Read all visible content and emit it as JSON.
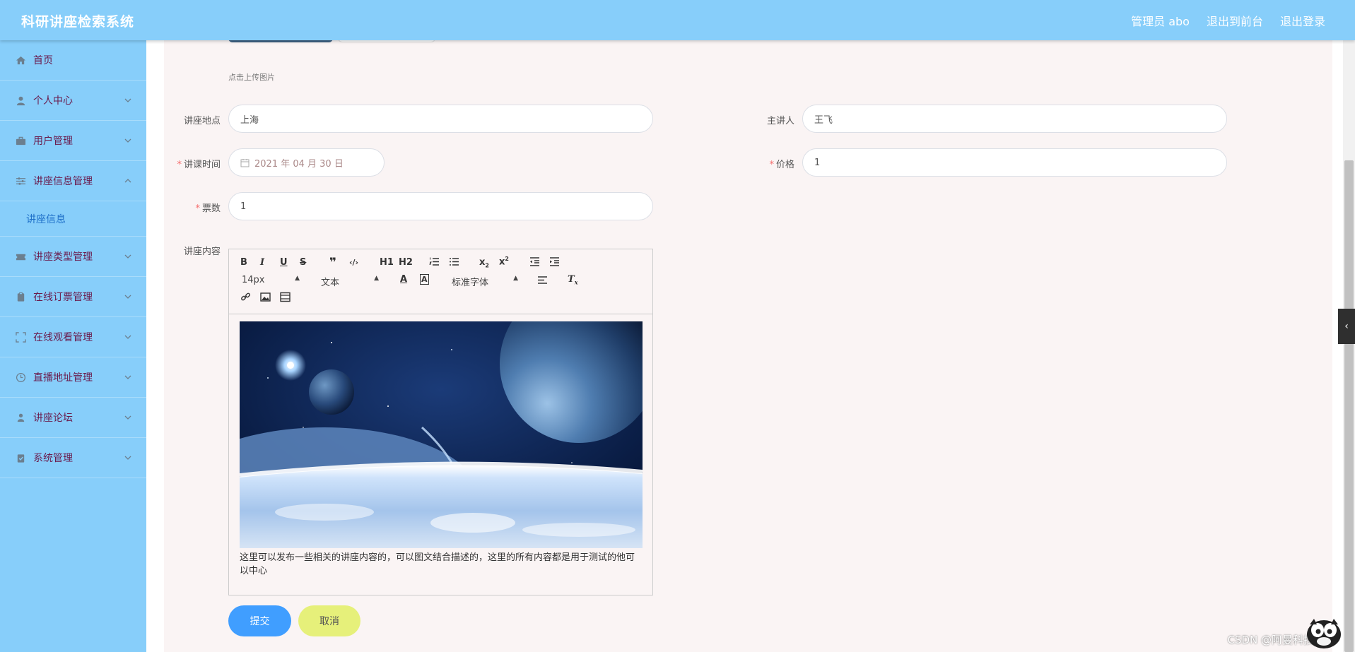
{
  "header": {
    "title": "科研讲座检索系统",
    "admin_label": "管理员 abo",
    "back_to_front": "退出到前台",
    "logout": "退出登录"
  },
  "sidebar": {
    "items": [
      {
        "label": "首页",
        "icon": "home-icon"
      },
      {
        "label": "个人中心",
        "icon": "user-icon"
      },
      {
        "label": "用户管理",
        "icon": "briefcase-icon"
      },
      {
        "label": "讲座信息管理",
        "icon": "sliders-icon"
      },
      {
        "label": "讲座类型管理",
        "icon": "ticket-icon"
      },
      {
        "label": "在线订票管理",
        "icon": "clipboard-icon"
      },
      {
        "label": "在线观看管理",
        "icon": "fullscreen-icon"
      },
      {
        "label": "直播地址管理",
        "icon": "clock-icon"
      },
      {
        "label": "讲座论坛",
        "icon": "person-icon"
      },
      {
        "label": "系统管理",
        "icon": "clipboard-check-icon"
      }
    ],
    "subitem": "讲座信息"
  },
  "form": {
    "upload_hint": "点击上传图片",
    "location_label": "讲座地点",
    "location_value": "上海",
    "speaker_label": "主讲人",
    "speaker_value": "王飞",
    "time_label": "讲课时间",
    "time_value": "2021 年 04 月 30 日",
    "price_label": "价格",
    "price_value": "1",
    "tickets_label": "票数",
    "tickets_value": "1",
    "content_label": "讲座内容",
    "required_mark": "*"
  },
  "editor": {
    "font_size": "14px",
    "block_type": "文本",
    "font_family": "标准字体",
    "h1": "H1",
    "h2": "H2",
    "content_text": "这里可以发布一些相关的讲座内容的，可以图文结合描述的，这里的所有内容都是用于测试的他可以中心"
  },
  "buttons": {
    "submit": "提交",
    "cancel": "取消"
  },
  "watermark": "CSDN @阿曼科技",
  "colors": {
    "header_bg": "#87cefa",
    "sidebar_bg": "#87cefa",
    "menu_text": "#6a1b4d",
    "submit_bg": "#409eff",
    "cancel_bg": "#e6f07a",
    "panel_bg": "#faf4f4"
  }
}
